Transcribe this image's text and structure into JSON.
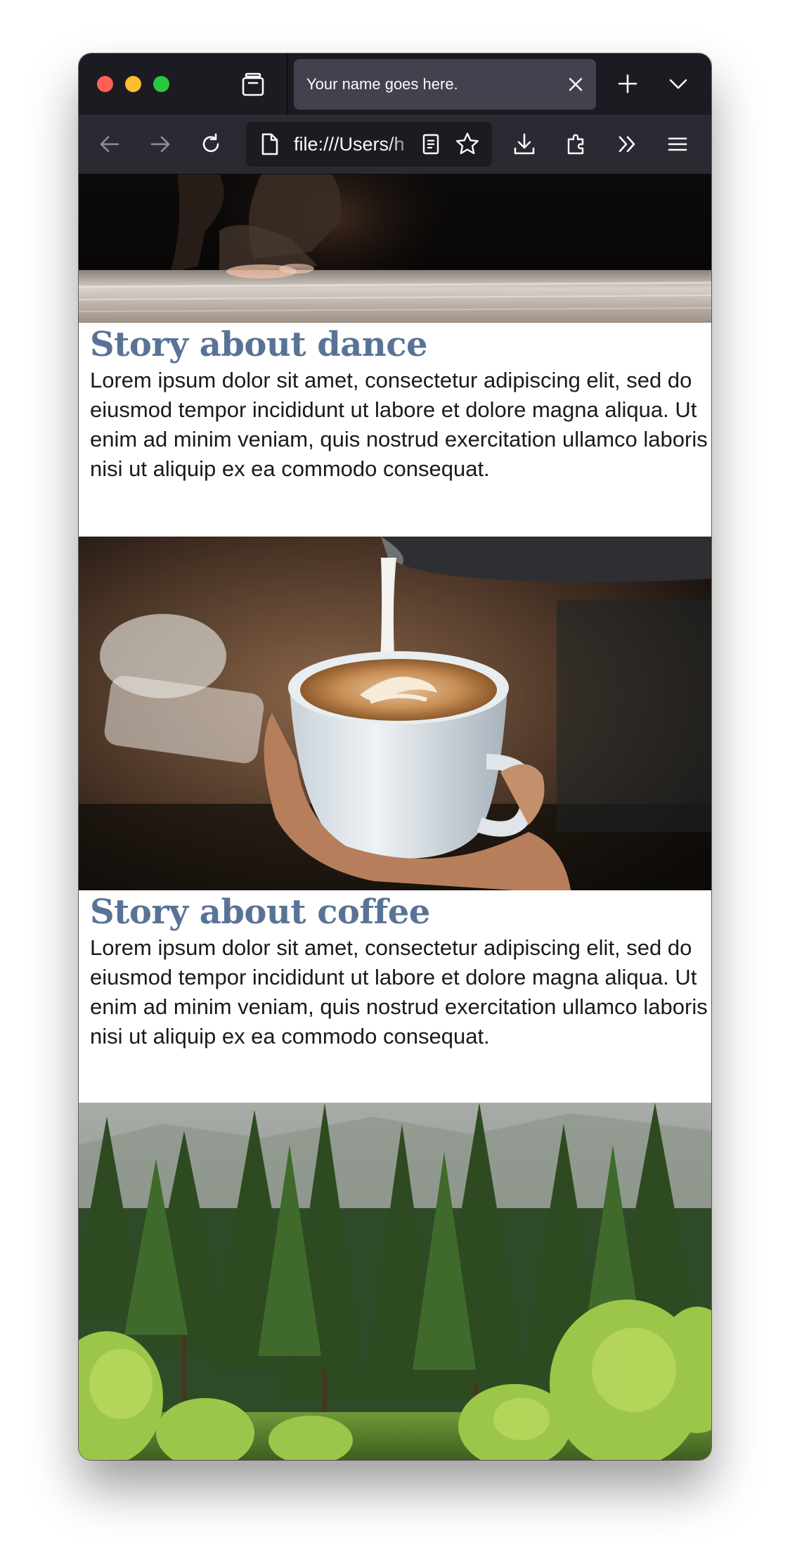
{
  "browser": {
    "tab_title": "Your name goes here.",
    "url": "file:///Users/h",
    "icons": {
      "tab_manager": "folder-icon",
      "tab_close": "close-icon",
      "new_tab": "plus-icon",
      "list_all_tabs": "chevron-down-icon",
      "back": "arrow-left-icon",
      "forward": "arrow-right-icon",
      "reload": "reload-icon",
      "page_info": "document-icon",
      "reader_view": "reader-view-icon",
      "bookmark": "star-icon",
      "downloads": "download-icon",
      "extensions": "puzzle-icon",
      "overflow": "double-chevron-icon",
      "menu": "hamburger-icon"
    },
    "colors": {
      "chrome_dark": "#1c1b22",
      "toolbar": "#2b2a33",
      "active_tab": "#42414d"
    }
  },
  "stories": [
    {
      "title": "Story about dance",
      "body": "Lorem ipsum dolor sit amet, consectetur adipiscing elit, sed do eiusmod tempor incididunt ut labore et dolore magna aliqua. Ut enim ad minim veniam, quis nostrud exercitation ullamco laboris nisi ut aliquip ex ea commodo consequat.",
      "image": "dance-photo"
    },
    {
      "title": "Story about coffee",
      "body": "Lorem ipsum dolor sit amet, consectetur adipiscing elit, sed do eiusmod tempor incididunt ut labore et dolore magna aliqua. Ut enim ad minim veniam, quis nostrud exercitation ullamco laboris nisi ut aliquip ex ea commodo consequat.",
      "image": "coffee-photo"
    },
    {
      "image": "forest-photo"
    }
  ],
  "colors": {
    "heading": "#587396",
    "body_text": "#1a1a1a"
  }
}
